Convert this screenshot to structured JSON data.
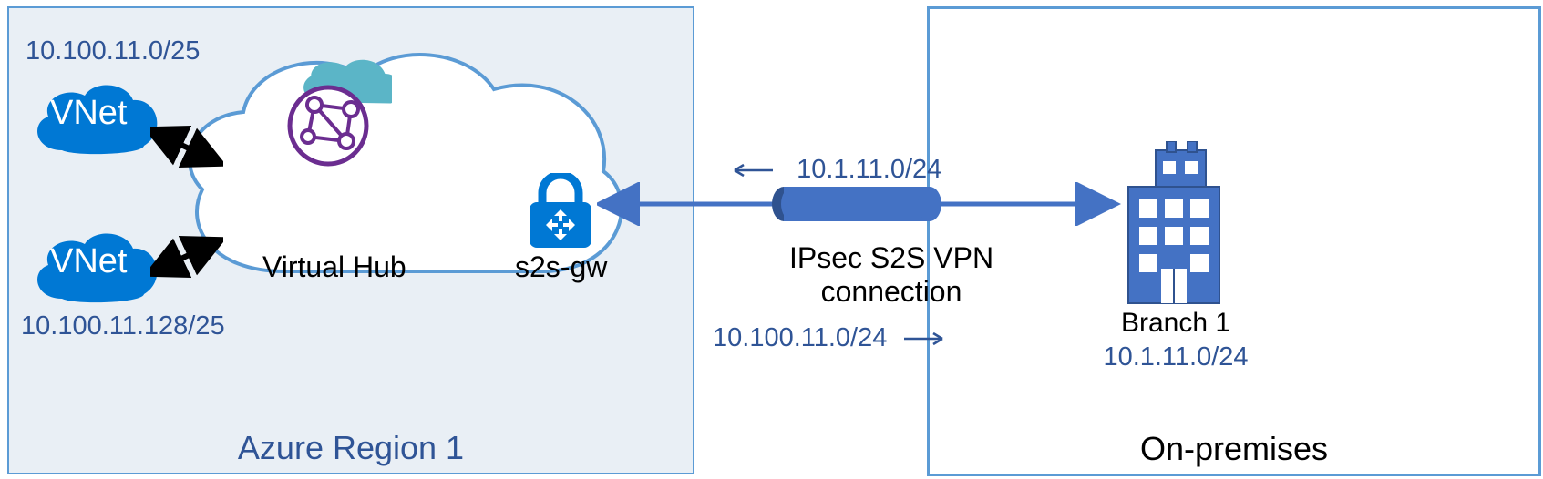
{
  "azure": {
    "title": "Azure Region 1",
    "vnets": [
      {
        "label": "VNet",
        "cidr": "10.100.11.0/25"
      },
      {
        "label": "VNet",
        "cidr": "10.100.11.128/25"
      }
    ],
    "hub": {
      "title": "Virtual Hub",
      "gateway_label": "s2s-gw"
    }
  },
  "connection": {
    "label": "IPsec S2S VPN connection",
    "advertise_from_branch": "10.1.11.0/24",
    "advertise_to_branch": "10.100.11.0/24"
  },
  "onprem": {
    "title": "On-premises",
    "branch_name": "Branch 1",
    "branch_cidr": "10.1.11.0/24"
  },
  "colors": {
    "azure_blue": "#0078d4",
    "border_blue": "#5b9bd5",
    "text_blue": "#2f5496",
    "purple": "#6b2d90",
    "teal": "#5bb5c7",
    "building": "#4472c4"
  }
}
